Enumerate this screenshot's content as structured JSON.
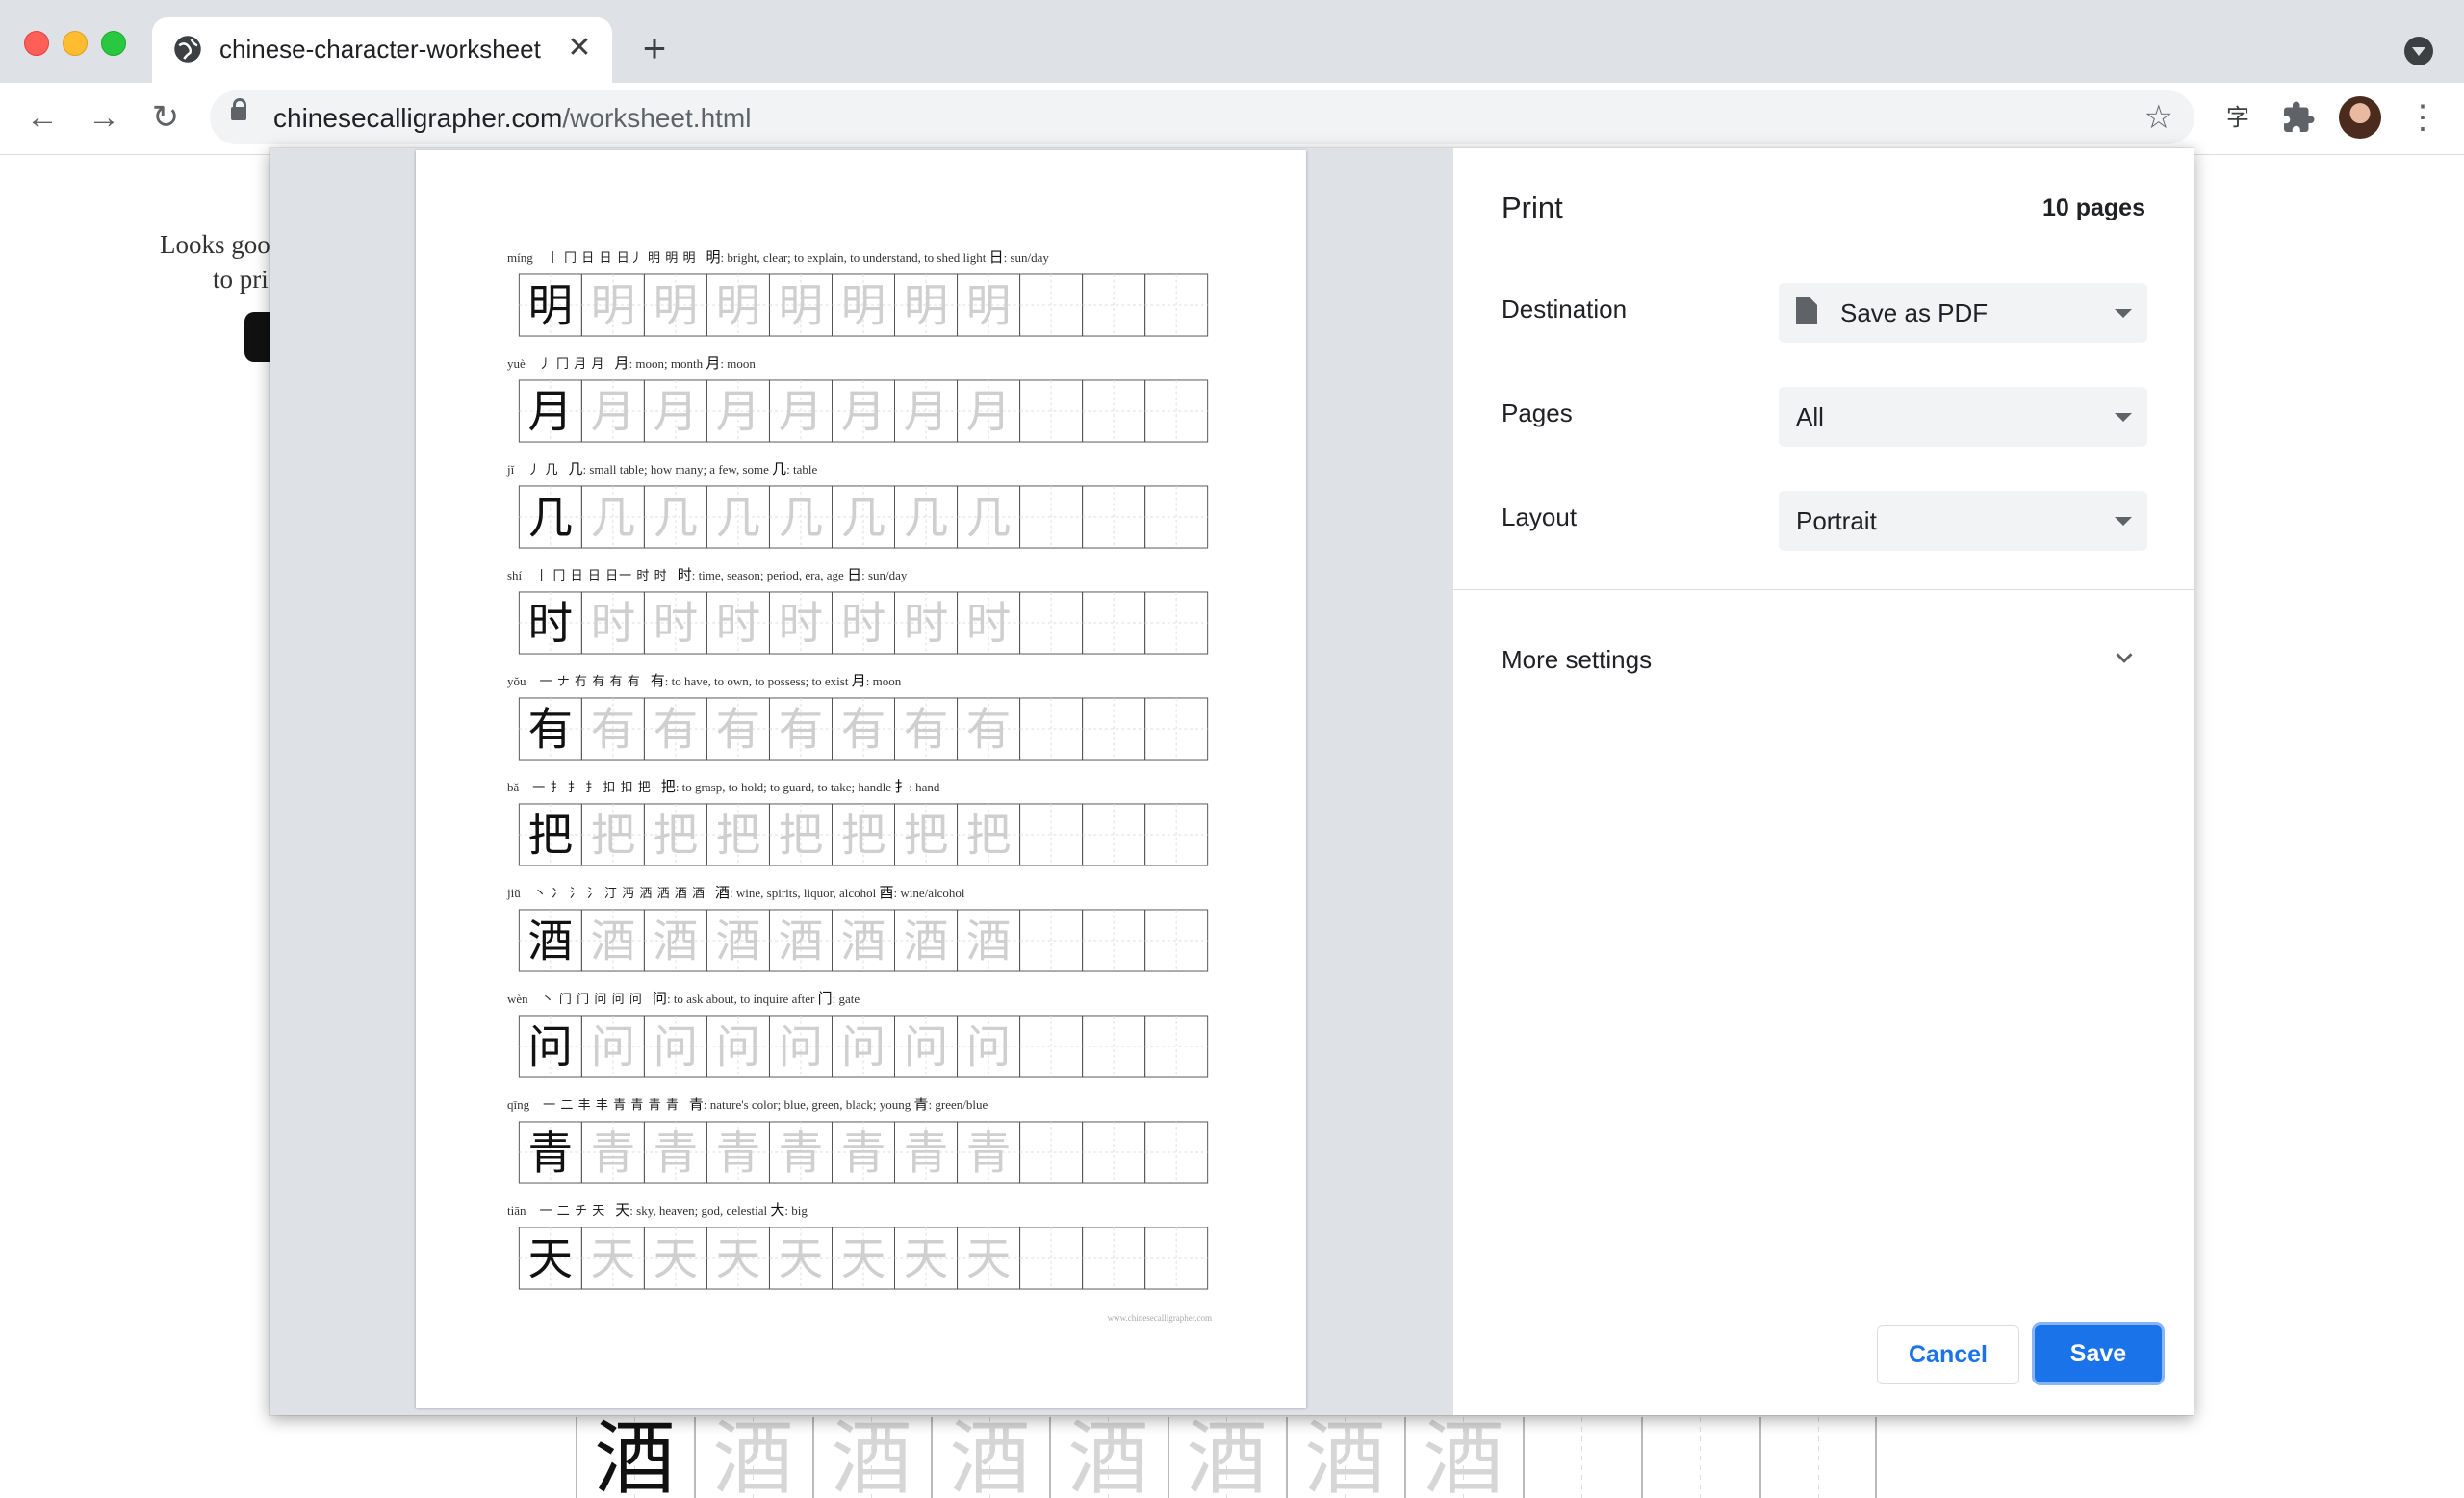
{
  "browser": {
    "tab_title": "chinese-character-worksheet",
    "url_host": "chinesecalligrapher.com",
    "url_path": "/worksheet.html",
    "extension_label": "字"
  },
  "background_page": {
    "line1": "Looks goo",
    "line2": "to pri",
    "grid_character": "酒"
  },
  "print": {
    "title": "Print",
    "page_count": "10 pages",
    "destination_label": "Destination",
    "destination_value": "Save as PDF",
    "pages_label": "Pages",
    "pages_value": "All",
    "layout_label": "Layout",
    "layout_value": "Portrait",
    "more_settings": "More settings",
    "cancel": "Cancel",
    "save": "Save"
  },
  "worksheet": {
    "footer": "www.chinesecalligrapher.com",
    "rows": [
      {
        "pinyin": "míng",
        "strokes": "丨 冂 日 日 日丿 明 明 明",
        "char": "明",
        "meaning": ": bright, clear; to explain, to understand, to shed light",
        "radical": "日",
        "radical_meaning": ": sun/day"
      },
      {
        "pinyin": "yuè",
        "strokes": "丿 冂 月 月",
        "char": "月",
        "meaning": ": moon; month",
        "radical": "月",
        "radical_meaning": ": moon"
      },
      {
        "pinyin": "jǐ",
        "strokes": "丿 几",
        "char": "几",
        "meaning": ": small table; how many; a few, some",
        "radical": "几",
        "radical_meaning": ": table"
      },
      {
        "pinyin": "shí",
        "strokes": "丨 冂 日 日 日一 时 时",
        "char": "时",
        "meaning": ": time, season; period, era, age",
        "radical": "日",
        "radical_meaning": ": sun/day"
      },
      {
        "pinyin": "yǒu",
        "strokes": "一 ナ 冇 有 有 有",
        "char": "有",
        "meaning": ": to have, to own, to possess; to exist",
        "radical": "月",
        "radical_meaning": ": moon"
      },
      {
        "pinyin": "bǎ",
        "strokes": "一 扌 扌 扌 扣 扣 把",
        "char": "把",
        "meaning": ": to grasp, to hold; to guard, to take; handle",
        "radical": "扌",
        "radical_meaning": ": hand"
      },
      {
        "pinyin": "jiǔ",
        "strokes": "丶 冫 氵 氵 汀 沔 洒 洒 酒 酒",
        "char": "酒",
        "meaning": ": wine, spirits, liquor, alcohol",
        "radical": "酉",
        "radical_meaning": ": wine/alcohol"
      },
      {
        "pinyin": "wèn",
        "strokes": "丶 门 门 问 问 问",
        "char": "问",
        "meaning": ": to ask about, to inquire after",
        "radical": "门",
        "radical_meaning": ": gate"
      },
      {
        "pinyin": "qīng",
        "strokes": "一 二 丰 丰 青 青 青 青",
        "char": "青",
        "meaning": ": nature's color; blue, green, black; young",
        "radical": "青",
        "radical_meaning": ": green/blue"
      },
      {
        "pinyin": "tiān",
        "strokes": "一 二 チ 天",
        "char": "天",
        "meaning": ": sky, heaven; god, celestial",
        "radical": "大",
        "radical_meaning": ": big"
      }
    ]
  },
  "colors": {
    "accent": "#1a73e8",
    "chrome": "#dee1e6",
    "trace": "#cfcfcf"
  },
  "icons": [
    "globe-icon",
    "close-icon",
    "plus-icon",
    "back-icon",
    "forward-icon",
    "reload-icon",
    "lock-icon",
    "star-icon",
    "puzzle-icon",
    "kebab-icon",
    "doc-icon",
    "chevron-down-icon"
  ]
}
